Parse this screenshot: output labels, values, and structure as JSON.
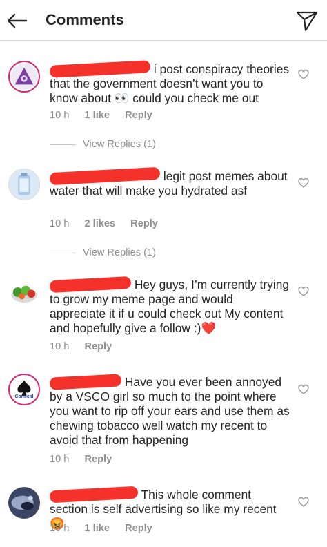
{
  "header": {
    "title": "Comments",
    "back_icon": "back-arrow-icon",
    "send_icon": "send-icon"
  },
  "comments": [
    {
      "text": "i post conspiracy theories that the government  doesn’t want you to know about 👀 could you check me out",
      "time": "10 h",
      "likes": "1 like",
      "reply": "Reply"
    },
    {
      "text": "legit post memes about water that will make you hydrated asf",
      "time": "10 h",
      "likes": "2 likes",
      "reply": "Reply"
    },
    {
      "text": "Hey guys, I’m currently trying to grow my meme page and would appreciate it if u could check out My content and hopefully give a follow :)❤️",
      "time": "10 h",
      "reply": "Reply"
    },
    {
      "text": "Have you ever been annoyed by a VSCO girl so much to the point where you want to rip off your ears and use them as chewing tobacco well watch my recent to avoid that from happening",
      "time": "10 h",
      "reply": "Reply",
      "avatar_text": "Comical"
    },
    {
      "text": "This whole comment section is self advertising so like my recent 😡",
      "time": "10 h",
      "likes": "1 like",
      "reply": "Reply"
    }
  ],
  "view_replies": [
    "View Replies (1)",
    "View Replies (1)"
  ],
  "colors": {
    "accent": "#d62976",
    "redaction": "#f4312b",
    "muted": "#8e8e8e",
    "text": "#262626"
  }
}
